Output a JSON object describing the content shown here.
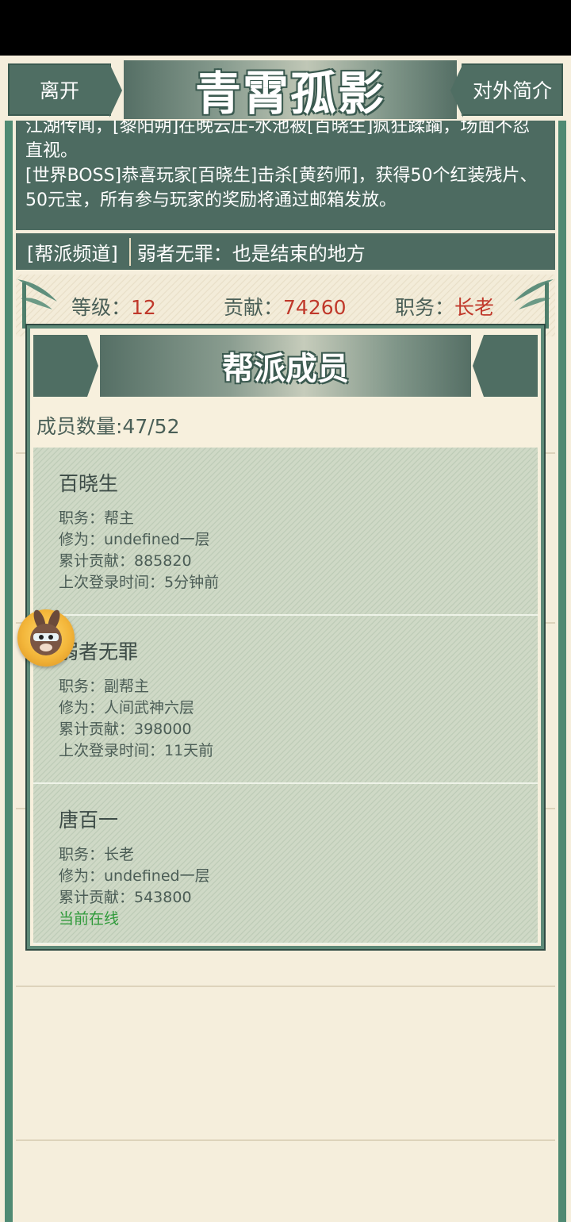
{
  "header": {
    "left_button": "离开",
    "title": "青霄孤影",
    "right_button": "对外简介"
  },
  "news": {
    "item1": "江湖传闻，[黎阳朔]在晚云庄-水池被[百晓生]疯狂蹂躏，场面不忍直视。",
    "item2": "[世界BOSS]恭喜玩家[百晓生]击杀[黄药师]，获得50个红装残片、50元宝，所有参与玩家的奖励将通过邮箱发放。"
  },
  "channel": {
    "tag": "[帮派频道]",
    "message": "弱者无罪：也是结束的地方"
  },
  "stats": {
    "level_label": "等级：",
    "level_value": "12",
    "contribution_label": "贡献：",
    "contribution_value": "74260",
    "position_label": "职务：",
    "position_value": "长老"
  },
  "panel": {
    "title": "帮派成员",
    "member_count": "成员数量:47/52",
    "members": [
      {
        "name": "百晓生",
        "role": "职务：帮主",
        "cultivation": "修为：undefined一层",
        "contribution": "累计贡献：885820",
        "last_login": "上次登录时间：5分钟前"
      },
      {
        "name": "弱者无罪",
        "role": "职务：副帮主",
        "cultivation": "修为：人间武神六层",
        "contribution": "累计贡献：398000",
        "last_login": "上次登录时间：11天前"
      },
      {
        "name": "唐百一",
        "role": "职务：长老",
        "cultivation": "修为：undefined一层",
        "contribution": "累计贡献：543800",
        "status": "当前在线"
      }
    ]
  },
  "colors": {
    "bg": "#f5eedc",
    "dark_green": "#4d6b61",
    "accent_red": "#c0392b",
    "online_green": "#2f9a3a"
  }
}
